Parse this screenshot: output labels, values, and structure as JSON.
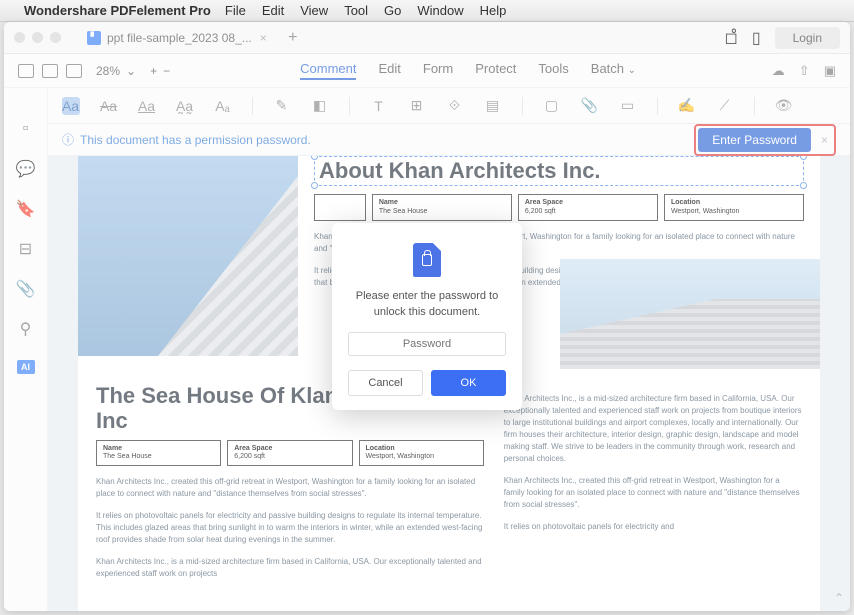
{
  "menubar": {
    "app": "Wondershare PDFelement Pro",
    "items": [
      "File",
      "Edit",
      "View",
      "Tool",
      "Go",
      "Window",
      "Help"
    ]
  },
  "tab": {
    "title": "ppt file-sample_2023 08_..."
  },
  "titlebar": {
    "login": "Login"
  },
  "toolbar": {
    "zoom": "28%",
    "tabs": [
      "Comment",
      "Edit",
      "Form",
      "Protect",
      "Tools",
      "Batch"
    ]
  },
  "perm": {
    "msg": "This document has a permission password.",
    "btn": "Enter Password"
  },
  "doc": {
    "h1": "About Khan Architects Inc.",
    "info": {
      "a_t": "Name",
      "a_v": "The Sea House",
      "b_t": "Area Space",
      "b_v": "6,200 sqft",
      "c_t": "Location",
      "c_v": "Westport, Washington"
    },
    "p1": "Khan Architects Inc., created this off-grid retreat in Westport, Washington for a family looking for an isolated place to connect with nature and \"distance themselves from social stresses\".",
    "p2": "It relies on photovoltaic panels for electricity and passive building designs to regulate its internal temperature. This includes glazed areas that bring sunlight in to warm the interiors in winter, while an extended west-facing roof provides shade from solar heat during evenings.",
    "h2": "The Sea House Of Klan Architects Inc",
    "p3": "Khan Architects Inc., created this off-grid retreat in Westport, Washington for a family looking for an isolated place to connect with nature and \"distance themselves from social stresses\".",
    "p4": "It relies on photovoltaic panels for electricity and passive building designs to regulate its internal temperature. This includes glazed areas that bring sunlight in to warm the interiors in winter, while an extended west-facing roof provides shade from solar heat during evenings in the summer.",
    "p5": "Khan Architects Inc., is a mid-sized architecture firm based in California, USA. Our exceptionally talented and experienced staff work on projects from boutique interiors to large institutional buildings and airport complexes, locally and internationally. Our firm houses their architecture, interior design, graphic design, landscape and model making staff. We strive to be leaders in the community through work, research and personal choices.",
    "p6": "Khan Architects Inc., created this off-grid retreat in Westport, Washington for a family looking for an isolated place to connect with nature and \"distance themselves from social stresses\".",
    "p7": "Khan Architects Inc., is a mid-sized architecture firm based in California, USA. Our exceptionally talented and experienced staff work on projects",
    "p8": "It relies on photovoltaic panels for electricity and"
  },
  "modal": {
    "msg": "Please enter the password to unlock this document.",
    "ph": "Password",
    "cancel": "Cancel",
    "ok": "OK"
  },
  "sidebar_ai": "AI"
}
